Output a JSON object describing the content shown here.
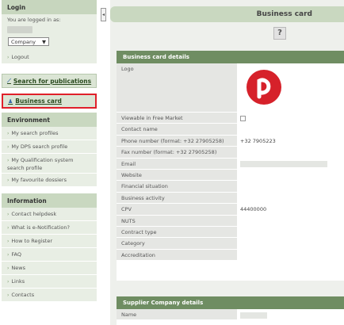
{
  "sidebar": {
    "login": {
      "header": "Login",
      "logged_in_as": "You are logged in as:",
      "company_select": "Company",
      "logout": "Logout"
    },
    "search_publications": "Search for publications",
    "business_card": "Business card",
    "environment": {
      "header": "Environment",
      "items": [
        "My search profiles",
        "My DPS search profile",
        "My Qualification system search profile",
        "My favourite dossiers"
      ]
    },
    "information": {
      "header": "Information",
      "items": [
        "Contact helpdesk",
        "What is e-Notification?",
        "How to Register",
        "FAQ",
        "News",
        "Links",
        "Contacts"
      ]
    }
  },
  "main": {
    "title": "Business card",
    "help": "?",
    "details": {
      "header": "Business card details",
      "rows": [
        {
          "label": "Logo",
          "value": ""
        },
        {
          "label": "Viewable in Free Market",
          "value": ""
        },
        {
          "label": "Contact name",
          "value": ""
        },
        {
          "label": "Phone number (format: +32 27905258)",
          "value": "+32 7905223"
        },
        {
          "label": "Fax number (format: +32 27905258)",
          "value": ""
        },
        {
          "label": "Email",
          "value": ""
        },
        {
          "label": "Website",
          "value": ""
        },
        {
          "label": "Financial situation",
          "value": ""
        },
        {
          "label": "Business activity",
          "value": ""
        },
        {
          "label": "CPV",
          "value": "44400000"
        },
        {
          "label": "NUTS",
          "value": ""
        },
        {
          "label": "Contract type",
          "value": ""
        },
        {
          "label": "Category",
          "value": ""
        },
        {
          "label": "Accreditation",
          "value": ""
        }
      ]
    },
    "supplier": {
      "header": "Supplier Company details",
      "rows": [
        {
          "label": "Name",
          "value": ""
        }
      ]
    }
  },
  "colors": {
    "sidebar_header": "#c9d8c0",
    "panel_header": "#6f8d62",
    "highlight_border": "#e0202a",
    "logo_red": "#d6212a"
  }
}
